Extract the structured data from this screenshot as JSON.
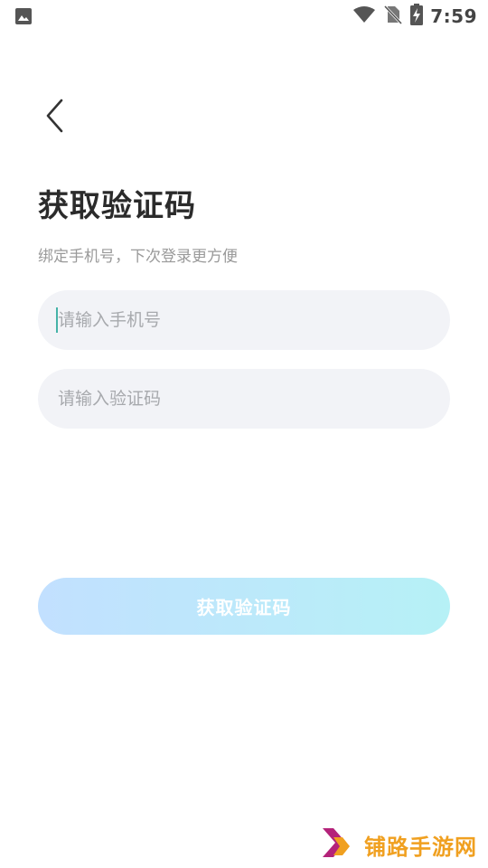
{
  "status_bar": {
    "time": "7:59",
    "icons": [
      "gallery-icon",
      "wifi-icon",
      "no-sim-icon",
      "battery-charging-icon"
    ]
  },
  "header": {
    "back_icon": "chevron-left-icon"
  },
  "title": "获取验证码",
  "subtitle": "绑定手机号，下次登录更方便",
  "form": {
    "phone": {
      "value": "",
      "placeholder": "请输入手机号"
    },
    "code": {
      "value": "",
      "placeholder": "请输入验证码"
    }
  },
  "submit_label": "获取验证码",
  "watermark": {
    "text": "铺路手游网"
  },
  "colors": {
    "button_gradient_start": "#c2e0ff",
    "button_gradient_end": "#b6f1f6",
    "input_bg": "#f2f3f7",
    "caret": "#45b3a8",
    "watermark_text": "#f0a020",
    "watermark_logo": "#b4237a"
  }
}
